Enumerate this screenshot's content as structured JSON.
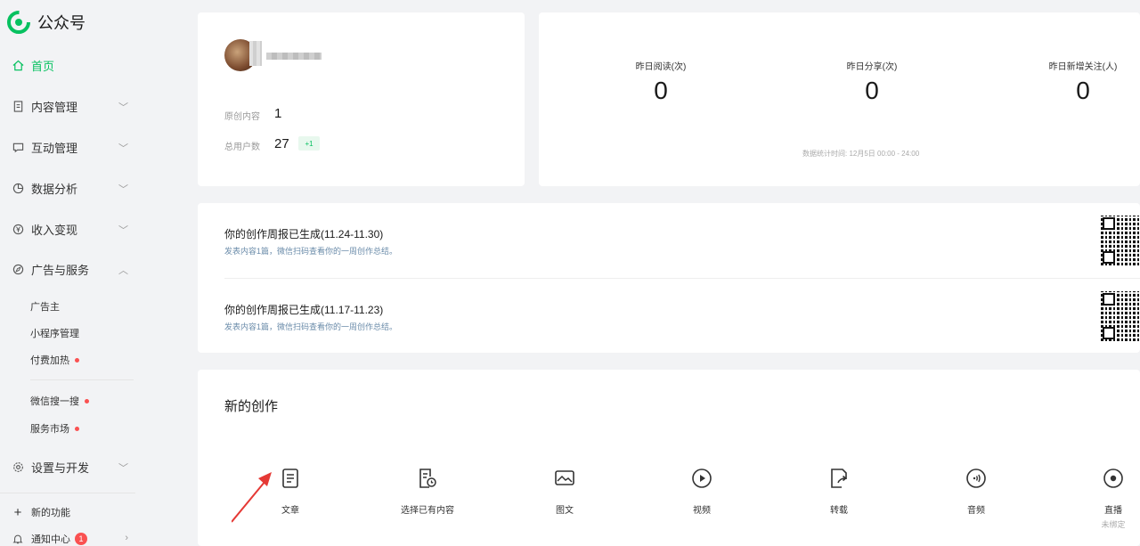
{
  "brand": {
    "name": "公众号",
    "logo_icon": "wechat-official-account-logo-icon",
    "color": "#07c160"
  },
  "sidebar": {
    "items": [
      {
        "label": "首页",
        "icon": "home-icon",
        "active": true
      },
      {
        "label": "内容管理",
        "icon": "document-icon",
        "expanded": false
      },
      {
        "label": "互动管理",
        "icon": "chat-icon",
        "expanded": false
      },
      {
        "label": "数据分析",
        "icon": "pie-chart-icon",
        "expanded": false
      },
      {
        "label": "收入变现",
        "icon": "yen-icon",
        "expanded": false
      },
      {
        "label": "广告与服务",
        "icon": "compass-icon",
        "expanded": true
      },
      {
        "label": "设置与开发",
        "icon": "settings-icon",
        "expanded": false
      }
    ],
    "sub_items": [
      {
        "label": "广告主",
        "dot": false
      },
      {
        "label": "小程序管理",
        "dot": false
      },
      {
        "label": "付费加热",
        "dot": true
      },
      {
        "label": "微信搜一搜",
        "dot": true
      },
      {
        "label": "服务市场",
        "dot": true
      }
    ],
    "new_feature": "新的功能",
    "notifications": {
      "label": "通知中心",
      "count": "1"
    }
  },
  "profile": {
    "original_label": "原创内容",
    "original_value": "1",
    "users_label": "总用户数",
    "users_value": "27",
    "users_delta": "+1"
  },
  "stats": {
    "metrics": [
      {
        "label": "昨日阅读(次)",
        "value": "0"
      },
      {
        "label": "昨日分享(次)",
        "value": "0"
      },
      {
        "label": "昨日新增关注(人)",
        "value": "0"
      }
    ],
    "note": "数据统计时间: 12月5日 00:00 - 24:00"
  },
  "reports": [
    {
      "title": "你的创作周报已生成(11.24-11.30)",
      "desc": "发表内容1篇，微信扫码查看你的一周创作总结。"
    },
    {
      "title": "你的创作周报已生成(11.17-11.23)",
      "desc": "发表内容1篇，微信扫码查看你的一周创作总结。"
    }
  ],
  "create": {
    "title": "新的创作",
    "tools": [
      {
        "label": "文章",
        "icon": "article-icon"
      },
      {
        "label": "选择已有内容",
        "icon": "existing-content-icon"
      },
      {
        "label": "图文",
        "icon": "image-text-icon"
      },
      {
        "label": "视频",
        "icon": "video-play-icon"
      },
      {
        "label": "转载",
        "icon": "repost-icon"
      },
      {
        "label": "音频",
        "icon": "audio-icon"
      },
      {
        "label": "直播",
        "icon": "live-icon",
        "sub": "未绑定"
      }
    ]
  }
}
